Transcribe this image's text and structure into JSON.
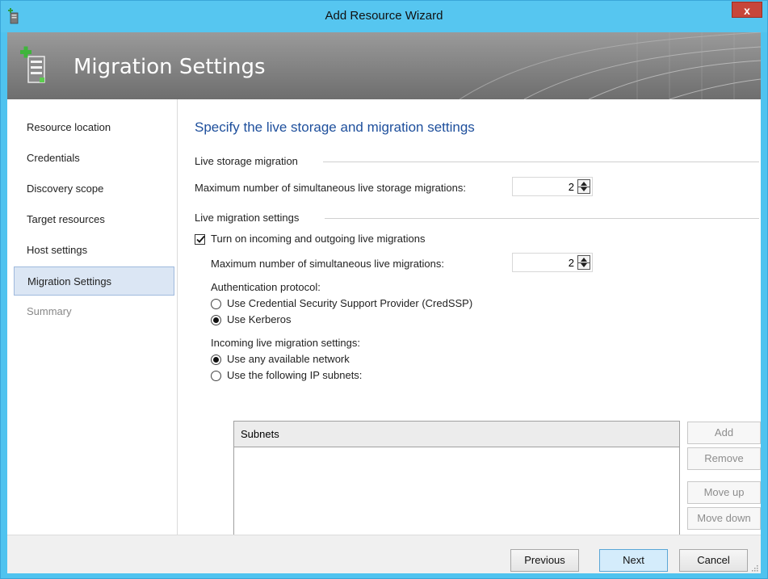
{
  "window": {
    "title": "Add Resource Wizard",
    "close_label": "x"
  },
  "banner": {
    "title": "Migration Settings"
  },
  "nav": {
    "items": [
      {
        "label": "Resource location"
      },
      {
        "label": "Credentials"
      },
      {
        "label": "Discovery scope"
      },
      {
        "label": "Target resources"
      },
      {
        "label": "Host settings"
      },
      {
        "label": "Migration Settings",
        "state": "active"
      },
      {
        "label": "Summary",
        "state": "disabled"
      }
    ]
  },
  "main": {
    "heading": "Specify the live storage and migration settings",
    "live_storage": {
      "group_label": "Live storage migration",
      "max_label": "Maximum number of simultaneous live storage migrations:",
      "max_value": "2"
    },
    "live_migration": {
      "group_label": "Live migration settings",
      "turn_on_label": "Turn on incoming and outgoing live migrations",
      "turn_on_checked": true,
      "max_label": "Maximum number of simultaneous live migrations:",
      "max_value": "2",
      "auth_label": "Authentication protocol:",
      "auth_options": [
        {
          "label": "Use Credential Security Support Provider (CredSSP)",
          "selected": false
        },
        {
          "label": "Use Kerberos",
          "selected": true
        }
      ],
      "incoming_label": "Incoming live migration settings:",
      "incoming_options": [
        {
          "label": "Use any available network",
          "selected": true
        },
        {
          "label": "Use the following IP subnets:",
          "selected": false
        }
      ],
      "subnets_header": "Subnets",
      "subnet_buttons": {
        "add": "Add",
        "remove": "Remove",
        "move_up": "Move up",
        "move_down": "Move down"
      }
    }
  },
  "footer": {
    "previous": "Previous",
    "next": "Next",
    "cancel": "Cancel"
  },
  "colors": {
    "titlebar": "#56c6f0",
    "heading": "#1e4f9c",
    "close": "#c7463a",
    "selected_nav": "#dbe6f4"
  }
}
